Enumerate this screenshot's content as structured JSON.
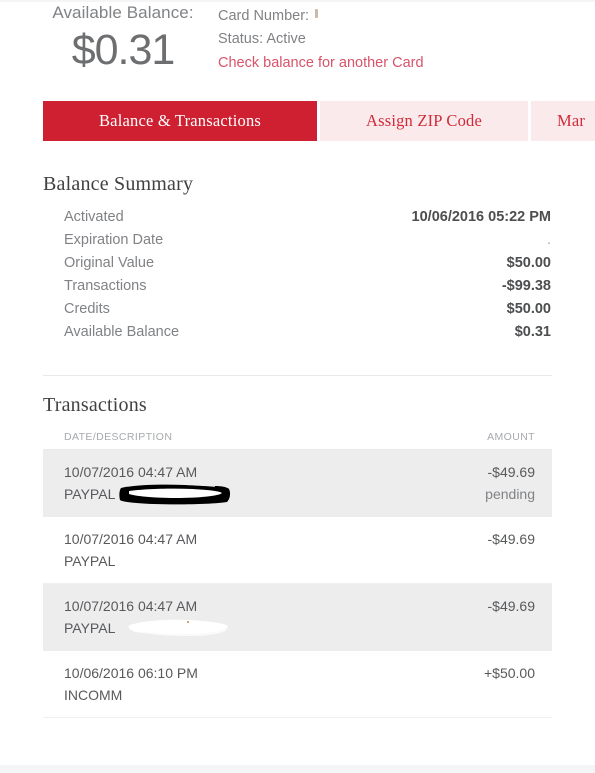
{
  "header": {
    "balance_label": "Available Balance:",
    "balance_amount": "$0.31",
    "card_number_label": "Card Number:",
    "status_label": "Status: Active",
    "check_another_link": "Check balance for another Card"
  },
  "tabs": [
    {
      "label": "Balance & Transactions",
      "active": true
    },
    {
      "label": "Assign ZIP Code",
      "active": false
    },
    {
      "label": "Mar",
      "active": false
    }
  ],
  "balance_summary": {
    "title": "Balance Summary",
    "rows": [
      {
        "key": "Activated",
        "value": "10/06/2016 05:22 PM"
      },
      {
        "key": "Expiration Date",
        "value": "."
      },
      {
        "key": "Original Value",
        "value": "$50.00"
      },
      {
        "key": "Transactions",
        "value": "-$99.38"
      },
      {
        "key": "Credits",
        "value": "$50.00"
      },
      {
        "key": "Available Balance",
        "value": "$0.31"
      }
    ]
  },
  "transactions": {
    "title": "Transactions",
    "columns": {
      "description": "DATE/DESCRIPTION",
      "amount": "AMOUNT"
    },
    "rows": [
      {
        "date": "10/07/2016 04:47 AM",
        "description": "PAYPAL",
        "amount": "-$49.69",
        "status": "pending",
        "shaded": true,
        "redaction": "dark"
      },
      {
        "date": "10/07/2016 04:47 AM",
        "description": "PAYPAL",
        "amount": "-$49.69",
        "status": "",
        "shaded": false,
        "redaction": "none"
      },
      {
        "date": "10/07/2016 04:47 AM",
        "description": "PAYPAL",
        "amount": "-$49.69",
        "status": "",
        "shaded": true,
        "redaction": "light"
      },
      {
        "date": "10/06/2016 06:10 PM",
        "description": "INCOMM",
        "amount": "+$50.00",
        "status": "",
        "shaded": false,
        "redaction": "none"
      }
    ]
  },
  "colors": {
    "accent_red": "#ce2030",
    "tab_inactive_bg": "#faeaeb",
    "tab_inactive_text": "#d12b3a",
    "link_red": "#d9536a",
    "row_shaded_bg": "#ededee",
    "text_gray": "#58595b",
    "label_gray": "#808285"
  }
}
